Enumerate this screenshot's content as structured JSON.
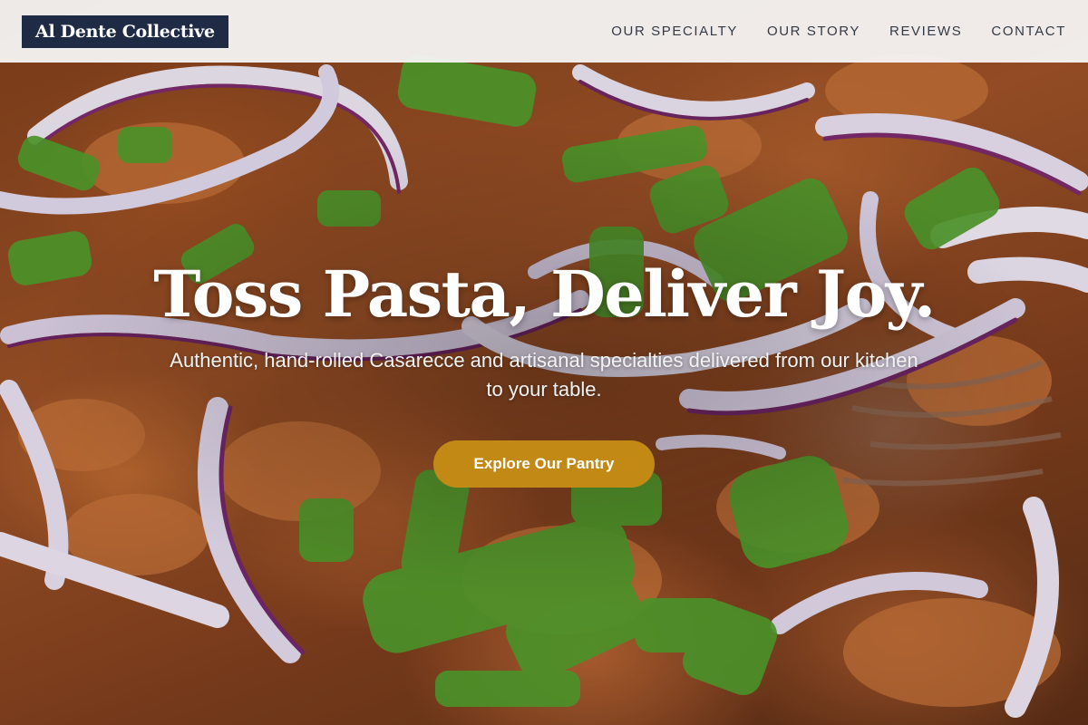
{
  "brand": {
    "name": "Al Dente Collective"
  },
  "nav": {
    "items": [
      {
        "label": "OUR SPECIALTY"
      },
      {
        "label": "OUR STORY"
      },
      {
        "label": "REVIEWS"
      },
      {
        "label": "CONTACT"
      }
    ]
  },
  "hero": {
    "title": "Toss Pasta, Deliver Joy.",
    "subtitle": "Authentic, hand-rolled Casarecce and artisanal specialties delivered from our kitchen to your table.",
    "cta_label": "Explore Our Pantry",
    "image": "pasta-with-red-onion-and-green-onion-photo"
  },
  "colors": {
    "header_bg": "#f5f5f5",
    "logo_bg": "#1f2a44",
    "cta_bg": "#c28a14",
    "nav_text": "#333a47"
  }
}
